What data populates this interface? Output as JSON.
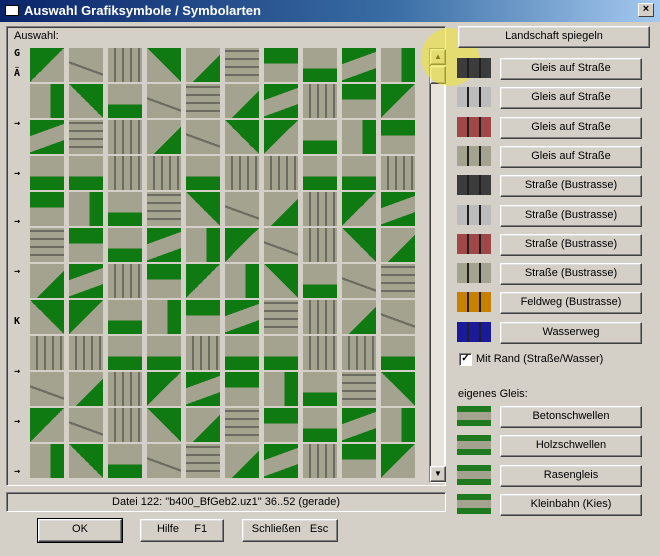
{
  "window": {
    "title": "Auswahl Grafiksymbole / Symbolarten",
    "close_glyph": "×"
  },
  "panel": {
    "label": "Auswahl:",
    "row_labels": [
      "G",
      "Ä",
      "→",
      "→",
      "→",
      "→",
      "K",
      "→",
      "→",
      "→"
    ]
  },
  "scrollbar": {
    "up_glyph": "▲",
    "down_glyph": "▼"
  },
  "status_text": "Datei 122: \"b400_BfGeb2.uz1\" 36..52 (gerade)",
  "buttons": {
    "ok": "OK",
    "help": "Hilfe     F1",
    "close": "Schließen   Esc",
    "mirror": "Landschaft spiegeln"
  },
  "options": [
    {
      "label": "Gleis auf Straße",
      "swatch_color": "#3c3c3c"
    },
    {
      "label": "Gleis auf Straße",
      "swatch_color": "#bcbcbc"
    },
    {
      "label": "Gleis auf Straße",
      "swatch_color": "#a04848"
    },
    {
      "label": "Gleis auf Straße",
      "swatch_color": "#a3a38f"
    },
    {
      "label": "Straße (Bustrasse)",
      "swatch_color": "#3c3c3c"
    },
    {
      "label": "Straße (Bustrasse)",
      "swatch_color": "#bcbcbc"
    },
    {
      "label": "Straße (Bustrasse)",
      "swatch_color": "#a04848"
    },
    {
      "label": "Straße (Bustrasse)",
      "swatch_color": "#a3a38f"
    },
    {
      "label": "Feldweg (Bustrasse)",
      "swatch_color": "#c88000"
    },
    {
      "label": "Wasserweg",
      "swatch_color": "#1a1a9a"
    }
  ],
  "checkbox": {
    "label": "Mit Rand (Straße/Wasser)",
    "checked_glyph": "✓"
  },
  "own_track": {
    "label": "eigenes Gleis:",
    "items": [
      {
        "label": "Betonschwellen",
        "swatch_color": "#1f7a1f"
      },
      {
        "label": "Holzschwellen",
        "swatch_color": "#1f7a1f"
      },
      {
        "label": "Rasengleis",
        "swatch_color": "#1f7a1f"
      },
      {
        "label": "Kleinbahn (Kies)",
        "swatch_color": "#1f7a1f"
      }
    ]
  },
  "colors": {
    "grass": "#0f7a12",
    "ballast": "#a3a38f",
    "rail": "#6c6c60",
    "titlebar": "#0a246a"
  }
}
